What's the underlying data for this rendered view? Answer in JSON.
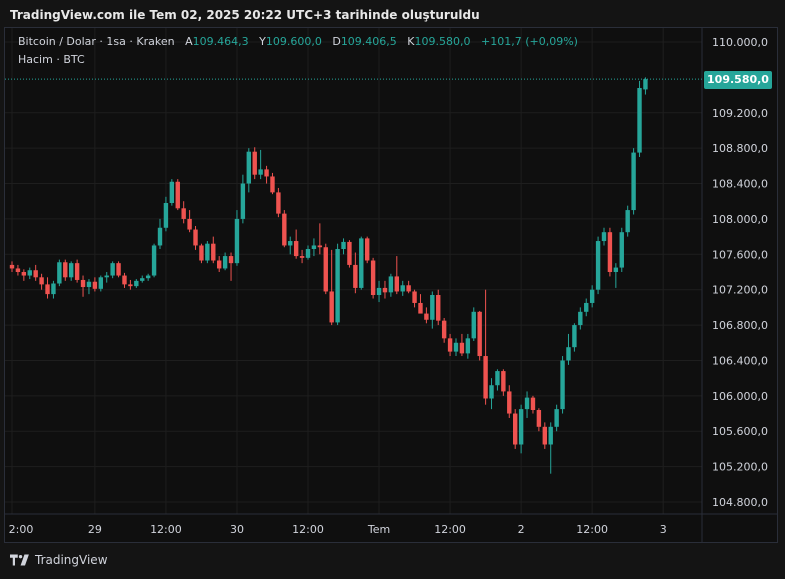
{
  "header": {
    "title": "TradingView.com ile Tem 02, 2025 20:22 UTC+3 tarihinde oluşturuldu"
  },
  "legend": {
    "symbol": "Bitcoin / Dolar · 1sa · Kraken",
    "open_label": "A",
    "open": "109.464,3",
    "high_label": "Y",
    "high": "109.600,0",
    "low_label": "D",
    "low": "109.406,5",
    "close_label": "K",
    "close": "109.580,0",
    "change": "+101,7 (+0,09%)",
    "volume": "Hacim · BTC"
  },
  "footer": {
    "brand": "TradingView"
  },
  "colors": {
    "up": "#26a69a",
    "down": "#ef5350",
    "background": "#0f0f0f",
    "grid": "#1e1e1e",
    "text": "#d1d4dc"
  },
  "chart_data": {
    "type": "candlestick",
    "last_price": 109580,
    "last_price_label": "109.580,0",
    "y_ticks": [
      110000,
      109200,
      108800,
      108400,
      108000,
      107600,
      107200,
      106800,
      106400,
      106000,
      105600,
      105200,
      104800
    ],
    "y_tick_labels": [
      "110.000,0",
      "109.200,0",
      "108.800,0",
      "108.400,0",
      "108.000,0",
      "107.600,0",
      "107.200,0",
      "106.800,0",
      "106.400,0",
      "106.000,0",
      "105.600,0",
      "105.200,0",
      "104.800,0"
    ],
    "x_tick_labels": [
      {
        "label": "2:00",
        "bar": 0
      },
      {
        "label": "29",
        "bar": 14
      },
      {
        "label": "12:00",
        "bar": 26
      },
      {
        "label": "30",
        "bar": 38
      },
      {
        "label": "12:00",
        "bar": 50
      },
      {
        "label": "Tem",
        "bar": 62
      },
      {
        "label": "12:00",
        "bar": 74
      },
      {
        "label": "2",
        "bar": 86
      },
      {
        "label": "12:00",
        "bar": 98
      },
      {
        "label": "3",
        "bar": 110
      }
    ],
    "candles": [
      [
        107480,
        107520,
        107400,
        107440
      ],
      [
        107440,
        107480,
        107360,
        107400
      ],
      [
        107400,
        107430,
        107300,
        107360
      ],
      [
        107360,
        107450,
        107320,
        107420
      ],
      [
        107420,
        107480,
        107300,
        107340
      ],
      [
        107340,
        107380,
        107200,
        107260
      ],
      [
        107260,
        107340,
        107100,
        107150
      ],
      [
        107150,
        107300,
        107100,
        107270
      ],
      [
        107270,
        107540,
        107240,
        107510
      ],
      [
        107510,
        107540,
        107300,
        107340
      ],
      [
        107340,
        107520,
        107300,
        107500
      ],
      [
        107500,
        107540,
        107280,
        107310
      ],
      [
        107310,
        107360,
        107120,
        107230
      ],
      [
        107230,
        107320,
        107150,
        107290
      ],
      [
        107290,
        107340,
        107180,
        107210
      ],
      [
        107210,
        107360,
        107180,
        107340
      ],
      [
        107340,
        107400,
        107280,
        107360
      ],
      [
        107360,
        107520,
        107330,
        107500
      ],
      [
        107500,
        107520,
        107340,
        107360
      ],
      [
        107360,
        107390,
        107220,
        107260
      ],
      [
        107260,
        107310,
        107200,
        107240
      ],
      [
        107240,
        107320,
        107220,
        107300
      ],
      [
        107300,
        107360,
        107280,
        107330
      ],
      [
        107330,
        107380,
        107300,
        107360
      ],
      [
        107360,
        107720,
        107340,
        107700
      ],
      [
        107700,
        108000,
        107660,
        107900
      ],
      [
        107900,
        108250,
        107860,
        108180
      ],
      [
        108180,
        108450,
        108150,
        108420
      ],
      [
        108420,
        108450,
        108100,
        108120
      ],
      [
        108120,
        108200,
        107950,
        108000
      ],
      [
        108000,
        108100,
        107850,
        107880
      ],
      [
        107880,
        107920,
        107650,
        107700
      ],
      [
        107700,
        107720,
        107500,
        107530
      ],
      [
        107530,
        107750,
        107500,
        107720
      ],
      [
        107720,
        107800,
        107500,
        107530
      ],
      [
        107530,
        107580,
        107400,
        107440
      ],
      [
        107440,
        107620,
        107420,
        107580
      ],
      [
        107580,
        107620,
        107300,
        107500
      ],
      [
        107500,
        108100,
        107470,
        108000
      ],
      [
        108000,
        108500,
        107950,
        108400
      ],
      [
        108400,
        108800,
        108300,
        108760
      ],
      [
        108760,
        108810,
        108450,
        108500
      ],
      [
        108500,
        108780,
        108450,
        108560
      ],
      [
        108560,
        108600,
        108400,
        108480
      ],
      [
        108480,
        108520,
        108280,
        108300
      ],
      [
        108300,
        108350,
        108020,
        108060
      ],
      [
        108060,
        108100,
        107680,
        107700
      ],
      [
        107700,
        107800,
        107600,
        107750
      ],
      [
        107750,
        107880,
        107550,
        107580
      ],
      [
        107580,
        107650,
        107500,
        107560
      ],
      [
        107560,
        107700,
        107540,
        107660
      ],
      [
        107660,
        107780,
        107580,
        107700
      ],
      [
        107700,
        107950,
        107600,
        107680
      ],
      [
        107680,
        107720,
        107150,
        107180
      ],
      [
        107180,
        107650,
        106800,
        106830
      ],
      [
        106830,
        107720,
        106800,
        107660
      ],
      [
        107660,
        107780,
        107600,
        107740
      ],
      [
        107740,
        107760,
        107450,
        107480
      ],
      [
        107480,
        107620,
        107160,
        107220
      ],
      [
        107220,
        107800,
        107200,
        107780
      ],
      [
        107780,
        107800,
        107500,
        107530
      ],
      [
        107530,
        107560,
        107100,
        107140
      ],
      [
        107140,
        107300,
        107060,
        107220
      ],
      [
        107220,
        107300,
        107100,
        107170
      ],
      [
        107170,
        107380,
        107120,
        107350
      ],
      [
        107350,
        107580,
        107150,
        107180
      ],
      [
        107180,
        107300,
        107130,
        107250
      ],
      [
        107250,
        107300,
        107160,
        107180
      ],
      [
        107180,
        107200,
        107000,
        107050
      ],
      [
        107050,
        107150,
        106950,
        106930
      ],
      [
        106930,
        107000,
        106820,
        106860
      ],
      [
        106860,
        107180,
        106760,
        107140
      ],
      [
        107140,
        107200,
        106800,
        106850
      ],
      [
        106850,
        106880,
        106600,
        106650
      ],
      [
        106650,
        106700,
        106450,
        106500
      ],
      [
        106500,
        106650,
        106450,
        106600
      ],
      [
        106600,
        106700,
        106450,
        106480
      ],
      [
        106480,
        106700,
        106420,
        106650
      ],
      [
        106650,
        107000,
        106620,
        106950
      ],
      [
        106950,
        106960,
        106400,
        106450
      ],
      [
        106450,
        107200,
        105900,
        105970
      ],
      [
        105970,
        106200,
        105850,
        106120
      ],
      [
        106120,
        106300,
        106060,
        106280
      ],
      [
        106280,
        106300,
        106000,
        106050
      ],
      [
        106050,
        106120,
        105750,
        105800
      ],
      [
        105800,
        105850,
        105400,
        105450
      ],
      [
        105450,
        105900,
        105350,
        105850
      ],
      [
        105850,
        106050,
        105750,
        105980
      ],
      [
        105980,
        106000,
        105800,
        105840
      ],
      [
        105840,
        105860,
        105600,
        105650
      ],
      [
        105650,
        105700,
        105400,
        105450
      ],
      [
        105450,
        105700,
        105120,
        105650
      ],
      [
        105650,
        105900,
        105600,
        105850
      ],
      [
        105850,
        106450,
        105800,
        106400
      ],
      [
        106400,
        106700,
        106350,
        106550
      ],
      [
        106550,
        106820,
        106500,
        106800
      ],
      [
        106800,
        107000,
        106750,
        106950
      ],
      [
        106950,
        107100,
        106900,
        107050
      ],
      [
        107050,
        107250,
        107000,
        107200
      ],
      [
        107200,
        107800,
        107150,
        107750
      ],
      [
        107750,
        107900,
        107700,
        107850
      ],
      [
        107850,
        107900,
        107350,
        107400
      ],
      [
        107400,
        107500,
        107220,
        107450
      ],
      [
        107450,
        107900,
        107400,
        107850
      ],
      [
        107850,
        108150,
        107800,
        108100
      ],
      [
        108100,
        108800,
        108050,
        108750
      ],
      [
        108750,
        109560,
        108700,
        109480
      ],
      [
        109464,
        109600,
        109406,
        109580
      ]
    ]
  }
}
